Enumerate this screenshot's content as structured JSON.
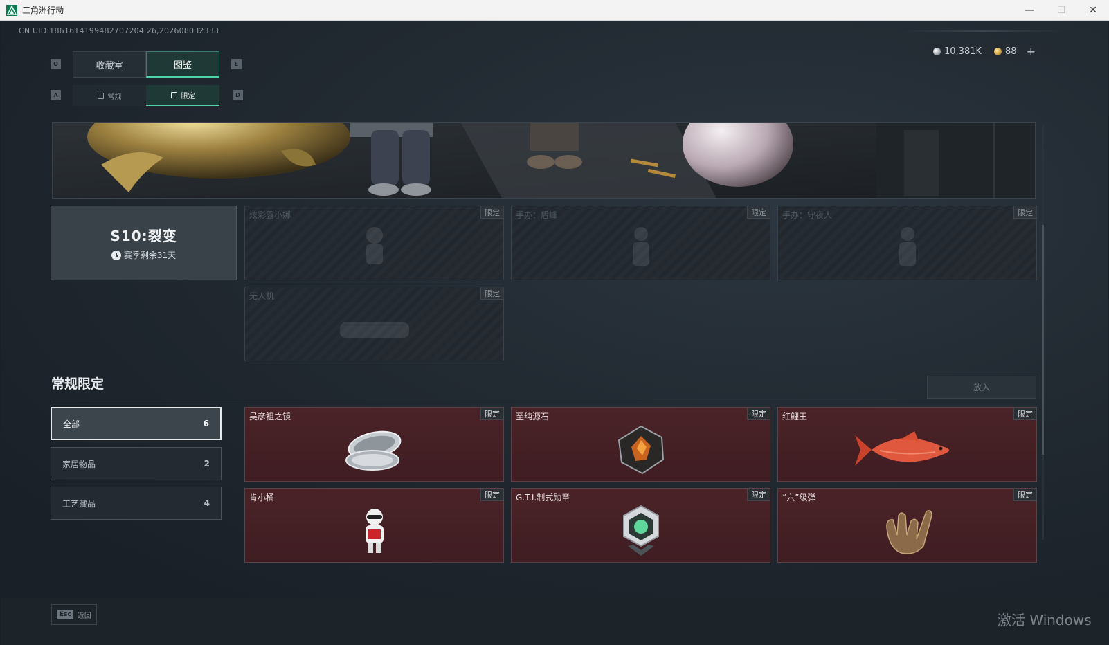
{
  "window": {
    "title": "三角洲行动",
    "controls": {
      "minimize": "—",
      "maximize": "☐",
      "close": "✕"
    }
  },
  "uid_text": "CN UID:1861614199482707204 26,202608032333",
  "currency": {
    "silver": "10,381K",
    "gold": "88",
    "plus": "+",
    "icons": {
      "silver": "silver-coin-icon",
      "gold": "gold-coin-icon"
    }
  },
  "keys": {
    "q": "Q",
    "e": "E",
    "a": "A",
    "d": "D"
  },
  "main_tabs": [
    {
      "label": "收藏室",
      "active": false
    },
    {
      "label": "图鉴",
      "active": true
    }
  ],
  "sub_tabs": [
    {
      "label": "常规",
      "active": false
    },
    {
      "label": "限定",
      "active": true
    }
  ],
  "season": {
    "title": "S10:裂变",
    "remaining": "赛季剩余31天"
  },
  "season_items": [
    {
      "name": "炫彩露小娜",
      "badge": "限定"
    },
    {
      "name": "手办：盾峰",
      "badge": "限定"
    },
    {
      "name": "手办：守夜人",
      "badge": "限定"
    },
    {
      "name": "无人机",
      "badge": "限定"
    }
  ],
  "section": {
    "title": "常规限定",
    "put_button": "放入"
  },
  "filters": [
    {
      "label": "全部",
      "count": "6",
      "active": true
    },
    {
      "label": "家居物品",
      "count": "2",
      "active": false
    },
    {
      "label": "工艺藏品",
      "count": "4",
      "active": false
    }
  ],
  "items": [
    {
      "name": "吴彦祖之镜",
      "badge": "限定",
      "icon": "mirror-icon"
    },
    {
      "name": "至纯源石",
      "badge": "限定",
      "icon": "gem-stone-icon"
    },
    {
      "name": "红鲤王",
      "badge": "限定",
      "icon": "red-carp-icon"
    },
    {
      "name": "肯小桶",
      "badge": "限定",
      "icon": "bucket-figure-icon"
    },
    {
      "name": "G.T.I.制式勋章",
      "badge": "限定",
      "icon": "medal-icon"
    },
    {
      "name": "“六”级弹",
      "badge": "限定",
      "icon": "hand-bullet-icon"
    }
  ],
  "footer": {
    "esc_key": "Esc",
    "esc_label": "返回",
    "watermark": "激活 Windows"
  },
  "colors": {
    "accent": "#4ed3a8",
    "owned_card": "#4a2328",
    "background": "#222a32"
  }
}
